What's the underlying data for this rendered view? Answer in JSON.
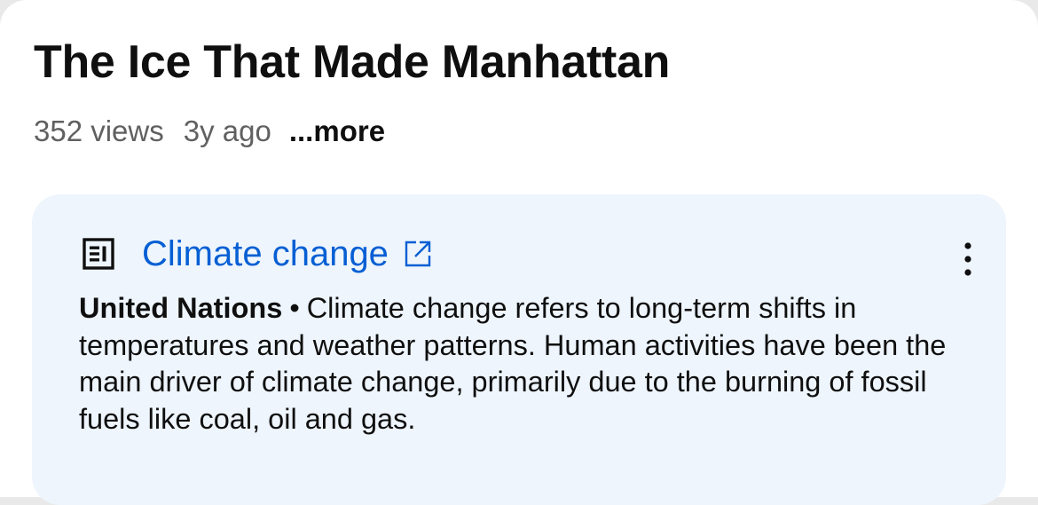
{
  "video": {
    "title": "The Ice That Made Manhattan",
    "views": "352 views",
    "age": "3y ago",
    "more_label": "...more"
  },
  "info_panel": {
    "link_title": "Climate change",
    "source": "United Nations",
    "separator": "•",
    "description": "Climate change refers to long-term shifts in temperatures and weather patterns. Human activities have been the main driver of climate change, primarily due to the burning of fossil fuels like coal, oil and gas.",
    "icons": {
      "leading": "article-icon",
      "trailing": "external-link-icon",
      "menu": "more-vert-icon"
    }
  },
  "colors": {
    "link": "#065fd4",
    "card_background": "#eef5fc",
    "secondary_text": "#606060",
    "primary_text": "#0f0f0f"
  }
}
